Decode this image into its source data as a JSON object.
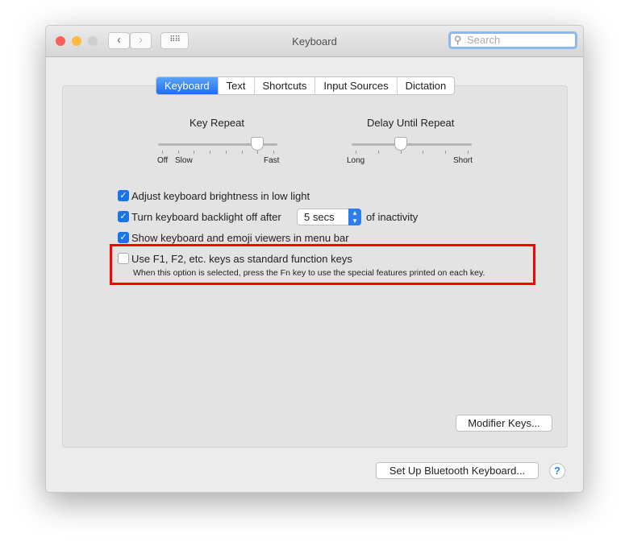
{
  "window": {
    "title": "Keyboard",
    "search_placeholder": "Search"
  },
  "tabs": [
    "Keyboard",
    "Text",
    "Shortcuts",
    "Input Sources",
    "Dictation"
  ],
  "selected_tab": "Keyboard",
  "key_repeat": {
    "label": "Key Repeat",
    "labels": [
      "Off",
      "Slow",
      "Fast"
    ],
    "value_fraction": 0.857
  },
  "delay_until_repeat": {
    "label": "Delay Until Repeat",
    "labels": [
      "Long",
      "Short"
    ],
    "value_fraction": 0.4
  },
  "options": [
    {
      "label": "Adjust keyboard brightness in low light",
      "checked": true
    },
    {
      "label": "Turn keyboard backlight off after",
      "checked": true,
      "select_value": "5 secs",
      "suffix": "of inactivity"
    },
    {
      "label": "Show keyboard and emoji viewers in menu bar",
      "checked": true
    },
    {
      "label": "Use F1, F2, etc. keys as standard function keys",
      "checked": false,
      "note": "When this option is selected, press the Fn key to use the special features printed on each key."
    }
  ],
  "buttons": {
    "modifier": "Modifier Keys...",
    "bluetooth": "Set Up Bluetooth Keyboard...",
    "help": "?"
  },
  "highlight_color": "#ff0000"
}
